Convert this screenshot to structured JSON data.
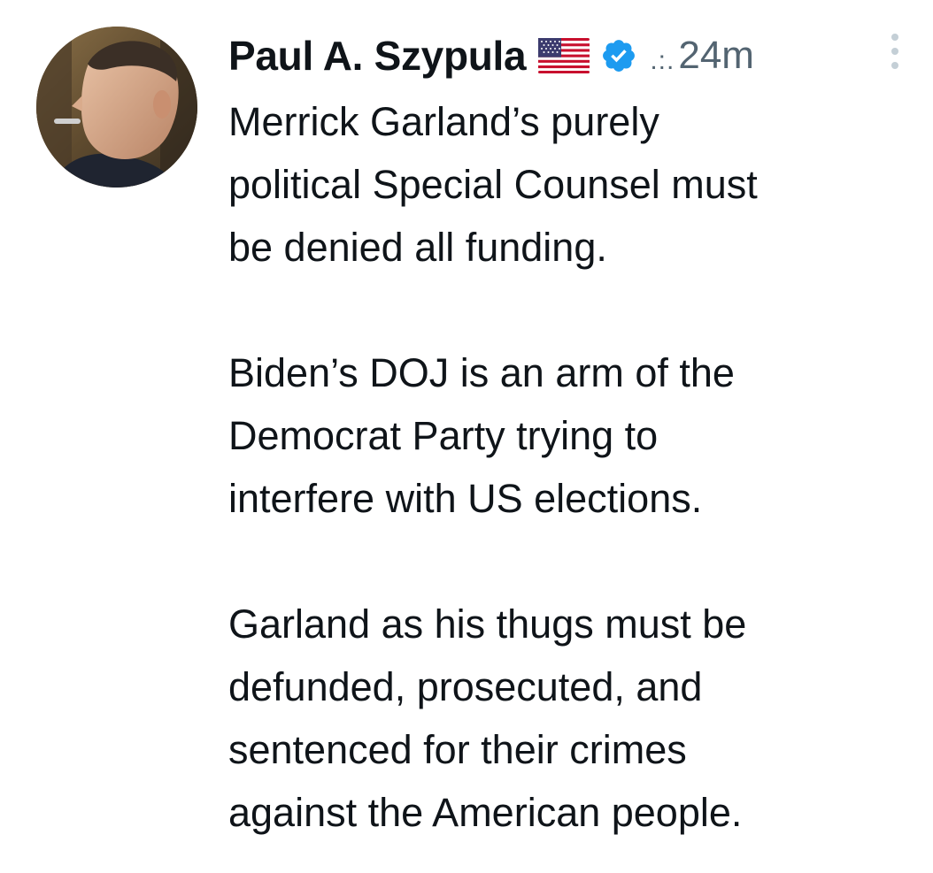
{
  "tweet": {
    "author_name": "Paul A. Szypula",
    "flag_icon": "us-flag-icon",
    "verified_icon": "verified-badge-icon",
    "verified_color": "#1d9bf0",
    "separator": ".:.",
    "time": "24m",
    "more_icon": "more-vertical-icon",
    "paragraphs": [
      "Merrick Garland’s purely\npolitical Special Counsel must\nbe denied all funding.",
      "Biden’s DOJ is an arm of the\nDemocrat Party trying to\ninterfere with US elections.",
      "Garland as his thugs must be\ndefunded, prosecuted, and\nsentenced for their crimes\nagainst the American people."
    ]
  }
}
